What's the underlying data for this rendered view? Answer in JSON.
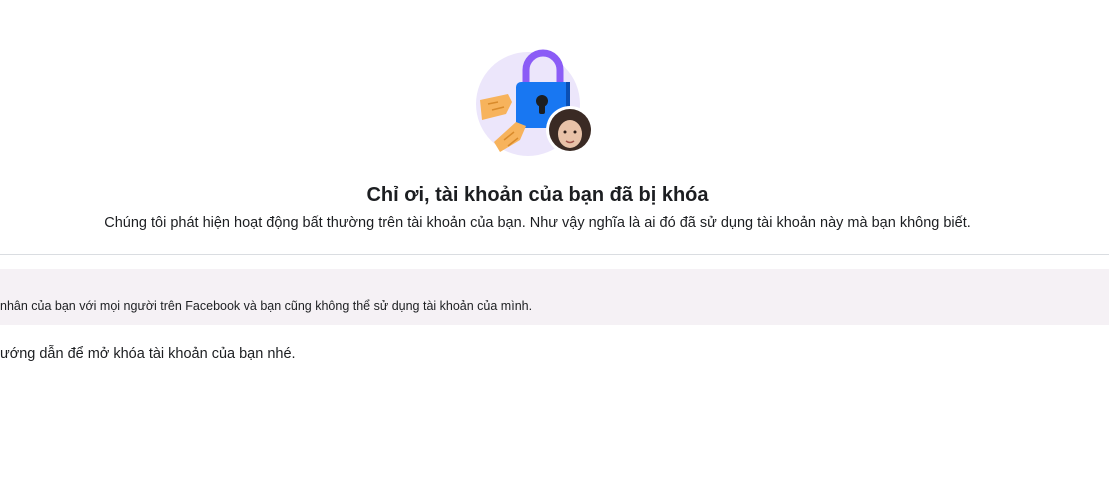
{
  "header": {
    "illustration_icon": "locked-account-illustration",
    "title": "Chỉ ơi, tài khoản của bạn đã bị khóa",
    "subtitle": "Chúng tôi phát hiện hoạt động bất thường trên tài khoản của bạn. Như vậy nghĩa là ai đó đã sử dụng tài khoản này mà bạn không biết."
  },
  "info_band": {
    "text": "nhân của bạn với mọi người trên Facebook và bạn cũng không thể sử dụng tài khoản của mình."
  },
  "instruction": {
    "text": "ướng dẫn để mở khóa tài khoản của bạn nhé."
  },
  "colors": {
    "lock_body": "#1877f2",
    "lock_shackle": "#8b5cf6",
    "circle_bg": "#ece6fb",
    "hand": "#f7b35c",
    "band_bg": "#f5f1f5",
    "divider": "#dadde1"
  }
}
